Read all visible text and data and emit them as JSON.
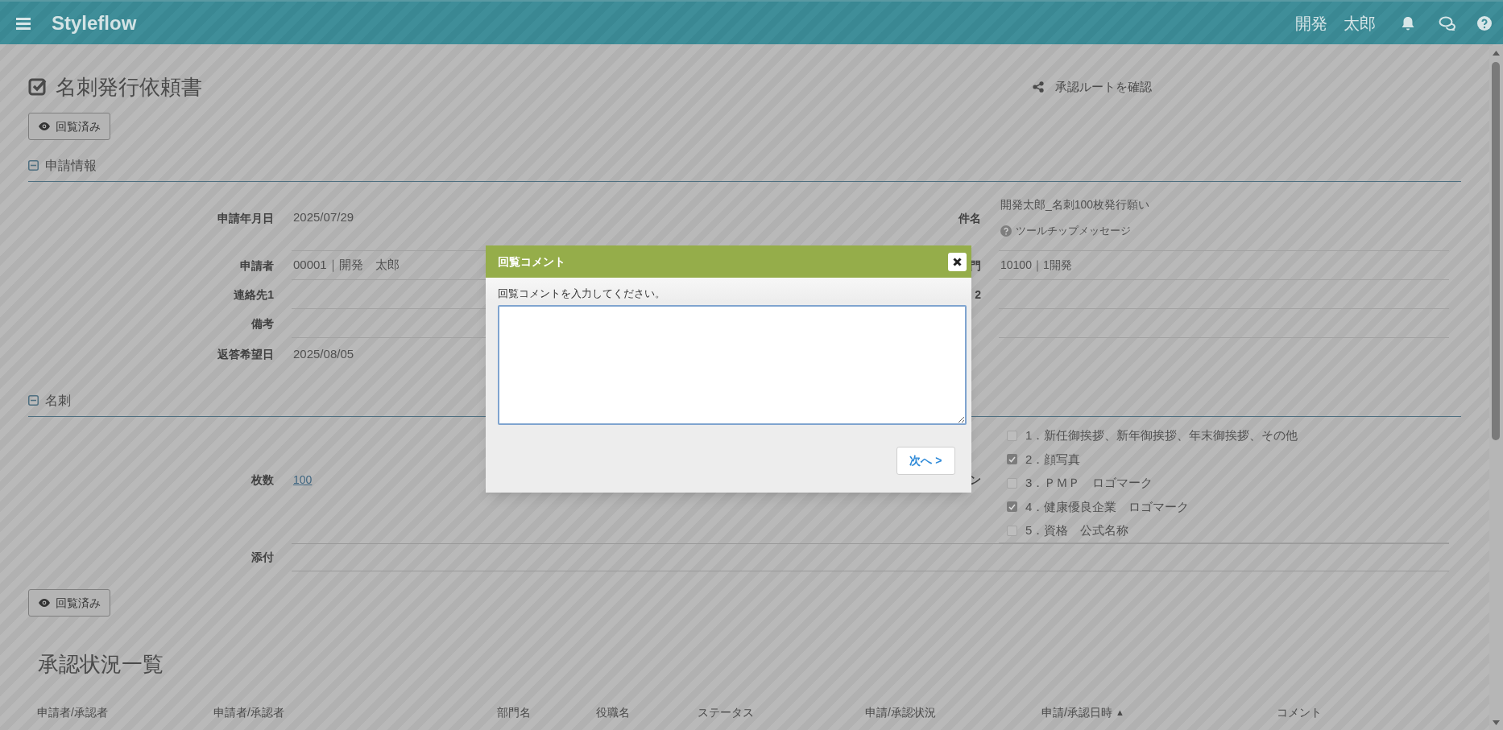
{
  "header": {
    "app_name": "Styleflow",
    "user_name": "開発　太郎"
  },
  "page": {
    "title": "名刺発行依頼書",
    "route_link": "承認ルートを確認"
  },
  "top_button": "回覧済み",
  "sections": [
    {
      "title": "申請情報",
      "expanded": true,
      "rows": [
        {
          "kind": "pair",
          "label": "申請年月日",
          "value": "2025/07/29",
          "label_2": "件名",
          "value_2": "開発太郎_名刺100枚発行願い",
          "tooltip": "ツールチップメッセージ"
        },
        {
          "kind": "pair",
          "label": "申請者",
          "value": "00001｜開発　太郎",
          "label_2": "門",
          "value_2": "10100｜1開発"
        },
        {
          "kind": "pair",
          "label": "連絡先1",
          "label_2": "2"
        },
        {
          "kind": "pair",
          "label": "備考"
        },
        {
          "kind": "pair",
          "label": "返答希望日",
          "value": "2025/08/05"
        }
      ]
    },
    {
      "title": "名刺",
      "expanded": true,
      "rows": [
        {
          "kind": "options",
          "label": "枚数",
          "value": "100",
          "label_2": "ン",
          "options": [
            {
              "label": "1．新任御挨拶、新年御挨拶、年末御挨拶、その他",
              "checked": false
            },
            {
              "label": "2．顔写真",
              "checked": true
            },
            {
              "label": "3．ＰＭＰ　ロゴマーク",
              "checked": false
            },
            {
              "label": "4．健康優良企業　ロゴマーク",
              "checked": true
            },
            {
              "label": "5．資格　公式名称",
              "checked": false
            }
          ]
        },
        {
          "kind": "wide",
          "label": "添付"
        }
      ]
    }
  ],
  "bottom_button": "回覧済み",
  "approval_list": {
    "title": "承認状況一覧",
    "columns": [
      {
        "label": "申請者/承認者"
      },
      {
        "label": "申請者/承認者"
      },
      {
        "label": "部門名"
      },
      {
        "label": "役職名"
      },
      {
        "label": "ステータス"
      },
      {
        "label": "申請/承認状況"
      },
      {
        "label": "申請/承認日時",
        "sort_mark": "▲"
      },
      {
        "label": "コメント"
      }
    ]
  },
  "dialog": {
    "title": "回覧コメント",
    "prompt": "回覧コメントを入力してください。",
    "next_button": "次へ >"
  }
}
